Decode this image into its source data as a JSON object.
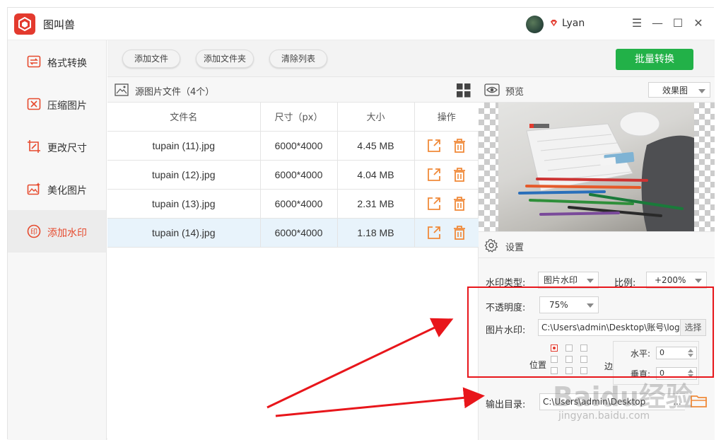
{
  "app": {
    "title": "图叫兽",
    "user": "Lyan"
  },
  "window_controls": {
    "menu": "☰",
    "minimize": "—",
    "maximize": "☐",
    "close": "✕"
  },
  "sidebar": {
    "items": [
      {
        "label": "格式转换",
        "icon": "convert-icon"
      },
      {
        "label": "压缩图片",
        "icon": "compress-icon"
      },
      {
        "label": "更改尺寸",
        "icon": "resize-icon"
      },
      {
        "label": "美化图片",
        "icon": "beautify-icon"
      },
      {
        "label": "添加水印",
        "icon": "watermark-icon",
        "active": true
      }
    ]
  },
  "toolbar": {
    "add_file": "添加文件",
    "add_folder": "添加文件夹",
    "clear_list": "清除列表",
    "batch_convert": "批量转换"
  },
  "files": {
    "title": "源图片文件（4个）",
    "columns": [
      "文件名",
      "尺寸（px）",
      "大小",
      "操作"
    ],
    "rows": [
      {
        "name": "tupain (11).jpg",
        "dim": "6000*4000",
        "size": "4.45 MB"
      },
      {
        "name": "tupain (12).jpg",
        "dim": "6000*4000",
        "size": "4.04 MB"
      },
      {
        "name": "tupain (13).jpg",
        "dim": "6000*4000",
        "size": "2.31 MB"
      },
      {
        "name": "tupain (14).jpg",
        "dim": "6000*4000",
        "size": "1.18 MB",
        "selected": true
      }
    ]
  },
  "preview": {
    "title": "预览",
    "mode": "效果图"
  },
  "settings": {
    "title": "设置",
    "type_label": "水印类型:",
    "type_value": "图片水印",
    "scale_label": "比例:",
    "scale_value": "+200%",
    "opacity_label": "不透明度:",
    "opacity_value": "75%",
    "image_label": "图片水印:",
    "image_path": "C:\\Users\\admin\\Desktop\\账号\\logo",
    "choose": "选择",
    "position_label": "位置",
    "margin_label": "边距",
    "horizontal_label": "水平:",
    "horizontal_value": "0",
    "vertical_label": "垂直:",
    "vertical_value": "0",
    "output_label": "输出目录:",
    "output_path": "C:\\Users\\admin\\Desktop",
    "more": "..."
  },
  "watermark": {
    "brand": "Baidu经验",
    "url": "jingyan.baidu.com"
  },
  "colors": {
    "accent": "#e64a2e",
    "primary_button": "#22b148",
    "annotation": "#e8161b"
  }
}
